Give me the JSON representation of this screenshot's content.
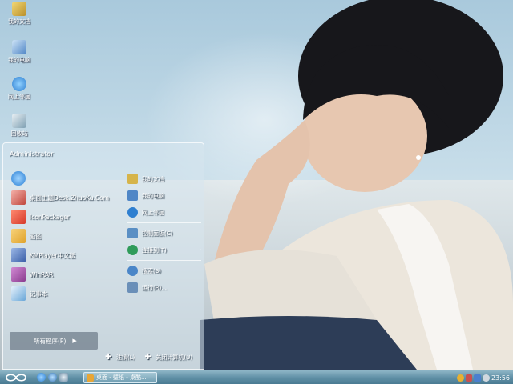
{
  "desktop": {
    "icons": [
      {
        "label": "我的文档",
        "icon": "my-documents-icon",
        "color": "#d6b44a"
      },
      {
        "label": "我的电脑",
        "icon": "my-computer-icon",
        "color": "#4f86c6"
      },
      {
        "label": "网上邻居",
        "icon": "network-icon",
        "color": "#2f7fd0"
      },
      {
        "label": "回收站",
        "icon": "recycle-bin-icon",
        "color": "#7d9fb2"
      }
    ]
  },
  "start_menu": {
    "user_name": "Administrator",
    "programs": [
      {
        "label": "",
        "icon": "internet-explorer-icon",
        "color": "#2a7fd4"
      },
      {
        "label": "桌面主题Desk.ZhuoKu.Com",
        "icon": "theme-app-icon",
        "color": "#c0473d"
      },
      {
        "label": "IconPackager",
        "icon": "iconpackager-icon",
        "color": "#d63a2a"
      },
      {
        "label": "画图",
        "icon": "paint-icon",
        "color": "#e0a32c"
      },
      {
        "label": "KMPlayer中文版",
        "icon": "kmplayer-icon",
        "color": "#3a5fa8"
      },
      {
        "label": "WinRAR",
        "icon": "winrar-icon",
        "color": "#8a3c8f"
      },
      {
        "label": "记事本",
        "icon": "notepad-icon",
        "color": "#6aa7d8"
      }
    ],
    "all_programs_label": "所有程序(P)",
    "places": [
      {
        "label": "我的文档",
        "icon": "my-documents-icon",
        "color": "#d6b44a",
        "arrow": ""
      },
      {
        "label": "我的电脑",
        "icon": "my-computer-icon",
        "color": "#4f86c6",
        "arrow": ""
      },
      {
        "label": "网上邻居",
        "icon": "network-icon",
        "color": "#2f7fd0",
        "arrow": ""
      },
      {
        "label": "控制面板(C)",
        "icon": "control-panel-icon",
        "color": "#5a8fc4",
        "arrow": ""
      },
      {
        "label": "连接到(T)",
        "icon": "connect-icon",
        "color": "#2f9b5a",
        "arrow": "›"
      },
      {
        "label": "搜索(S)",
        "icon": "search-icon",
        "color": "#4a86c8",
        "arrow": ""
      },
      {
        "label": "运行(R)...",
        "icon": "run-icon",
        "color": "#6a8fb8",
        "arrow": ""
      }
    ],
    "logoff_label": "注销(L)",
    "shutdown_label": "关闭计算机(U)"
  },
  "taskbar": {
    "task_label": "桌面 - 壁纸 - 桌酷...",
    "clock": "23:56",
    "colors": {
      "accent": "#5f8fa5"
    }
  }
}
